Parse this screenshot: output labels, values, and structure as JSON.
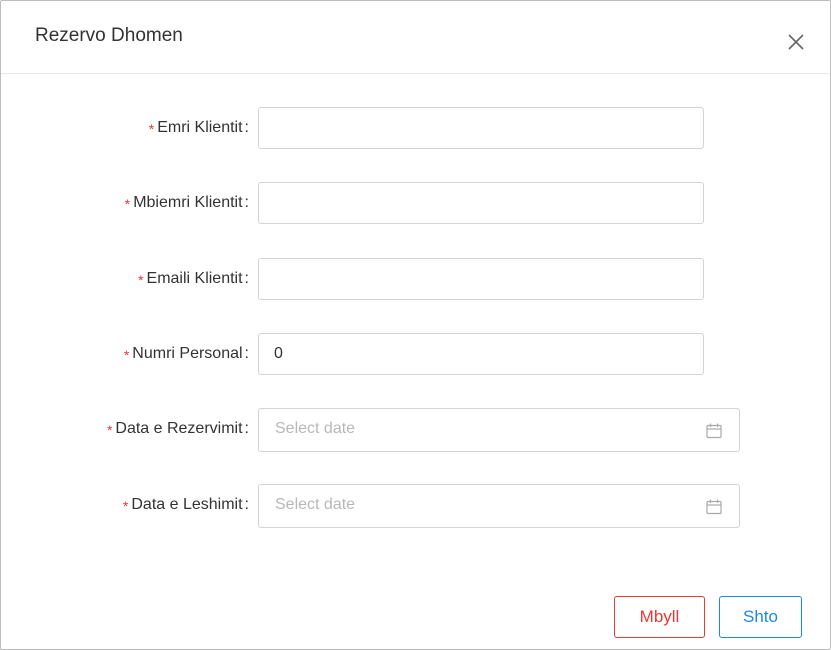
{
  "modal": {
    "title": "Rezervo Dhomen"
  },
  "fields": [
    {
      "label": "Emri Klientit",
      "value": "",
      "required_mark": "*"
    },
    {
      "label": "Mbiemri Klientit",
      "value": "",
      "required_mark": "*"
    },
    {
      "label": "Emaili Klientit",
      "value": "",
      "required_mark": "*"
    },
    {
      "label": "Numri Personal",
      "value": "0",
      "required_mark": "*"
    },
    {
      "label": "Data e Rezervimit",
      "placeholder": "Select date",
      "required_mark": "*",
      "icon": "calendar-icon"
    },
    {
      "label": "Data e Leshimit",
      "placeholder": "Select date",
      "required_mark": "*",
      "icon": "calendar-icon"
    }
  ],
  "colon": ":",
  "buttons": {
    "close_label": "Mbyll",
    "add_label": "Shto"
  },
  "colors": {
    "required": "#e53935",
    "close_button": "#e53935",
    "add_button": "#1e88e5"
  }
}
